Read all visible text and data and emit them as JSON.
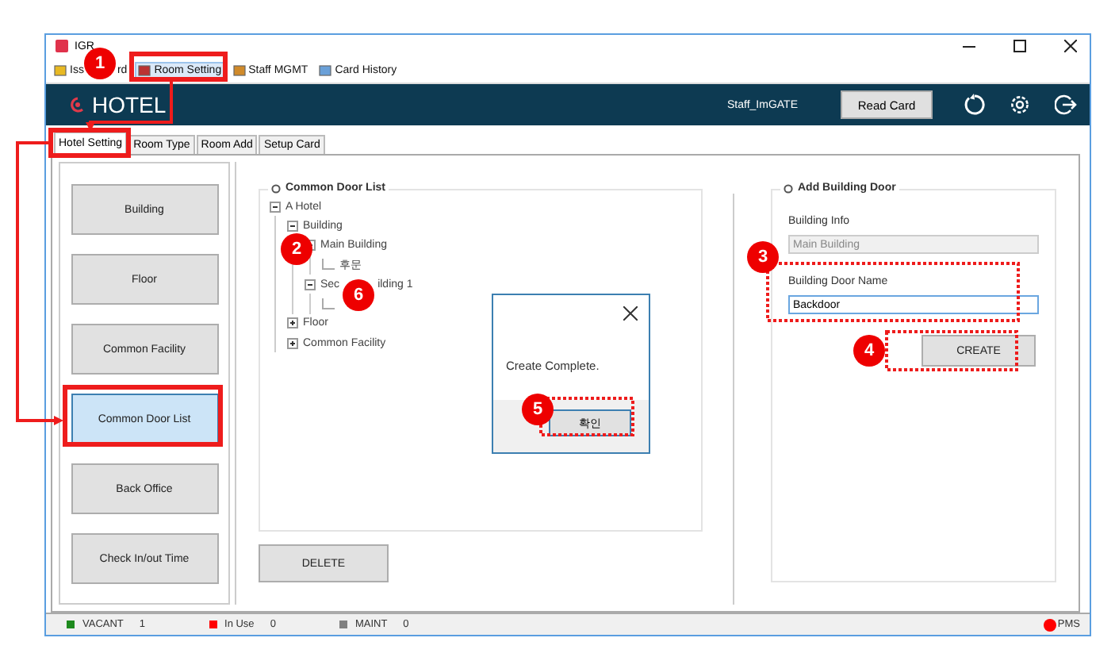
{
  "window": {
    "title": "IGR"
  },
  "toolbar": [
    {
      "label": "Iss",
      "label_end": "rd",
      "selected": false
    },
    {
      "label": "Room Setting",
      "selected": true
    },
    {
      "label": "Staff MGMT",
      "selected": false
    },
    {
      "label": "Card History",
      "selected": false
    }
  ],
  "header": {
    "logo": "HOTEL",
    "user": "Staff_ImGATE",
    "read_card_button": "Read Card"
  },
  "tabs": [
    {
      "label": "Hotel Setting",
      "selected": true
    },
    {
      "label": "Room Type",
      "selected": false
    },
    {
      "label": "Room Add",
      "selected": false
    },
    {
      "label": "Setup Card",
      "selected": false
    }
  ],
  "side_menu": [
    {
      "label": "Building",
      "selected": false
    },
    {
      "label": "Floor",
      "selected": false
    },
    {
      "label": "Common Facility",
      "selected": false
    },
    {
      "label": "Common Door List",
      "selected": true
    },
    {
      "label": "Back Office",
      "selected": false
    },
    {
      "label": "Check In/out Time",
      "selected": false
    }
  ],
  "door_list": {
    "title": "Common Door List",
    "tree": [
      {
        "label": "A Hotel",
        "expanded": true,
        "children": [
          {
            "label": "Building",
            "expanded": true,
            "children": [
              {
                "label": "Main Building",
                "expanded": true,
                "children": [
                  {
                    "label": "후문"
                  }
                ]
              },
              {
                "label": "Sec",
                "label_end": "ilding 1",
                "expanded": true
              }
            ]
          },
          {
            "label": "Floor",
            "expanded": false
          },
          {
            "label": "Common Facility",
            "expanded": false
          }
        ]
      }
    ],
    "delete_button": "DELETE"
  },
  "add_door": {
    "title": "Add Building Door",
    "info_label": "Building Info",
    "info_value": "Main Building",
    "name_label": "Building Door Name",
    "name_value": "Backdoor",
    "create_button": "CREATE"
  },
  "dialog": {
    "message": "Create Complete.",
    "ok_button": "확인"
  },
  "status_bar": [
    {
      "label": "VACANT",
      "count": "1",
      "color": "#1e8a1e"
    },
    {
      "label": "In Use",
      "count": "0",
      "color": "#ff0000"
    },
    {
      "label": "MAINT",
      "count": "0",
      "color": "#808080"
    }
  ],
  "pms": {
    "label": "PMS"
  },
  "annotations": [
    {
      "number": "1"
    },
    {
      "number": "2"
    },
    {
      "number": "3"
    },
    {
      "number": "4"
    },
    {
      "number": "5"
    },
    {
      "number": "6"
    }
  ]
}
